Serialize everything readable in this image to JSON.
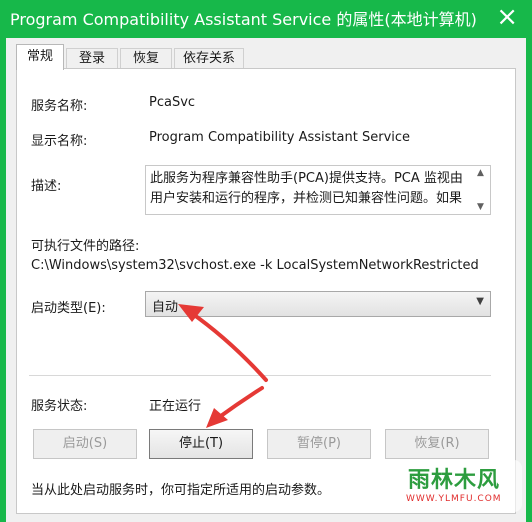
{
  "window": {
    "title": "Program Compatibility Assistant Service 的属性(本地计算机)",
    "close_glyph": "×"
  },
  "tabs": [
    {
      "label": "常规",
      "active": true
    },
    {
      "label": "登录",
      "active": false
    },
    {
      "label": "恢复",
      "active": false
    },
    {
      "label": "依存关系",
      "active": false
    }
  ],
  "general": {
    "service_name_label": "服务名称:",
    "service_name_value": "PcaSvc",
    "display_name_label": "显示名称:",
    "display_name_value": "Program Compatibility Assistant Service",
    "description_label": "描述:",
    "description_value": "此服务为程序兼容性助手(PCA)提供支持。PCA 监视由用户安装和运行的程序，并检测已知兼容性问题。如果",
    "path_label": "可执行文件的路径:",
    "path_value": "C:\\Windows\\system32\\svchost.exe -k LocalSystemNetworkRestricted",
    "startup_type_label": "启动类型(E):",
    "startup_type_value": "自动",
    "status_label": "服务状态:",
    "status_value": "正在运行",
    "hint": "当从此处启动服务时，你可指定所适用的启动参数。"
  },
  "buttons": {
    "start": {
      "label": "启动(S)",
      "enabled": false
    },
    "stop": {
      "label": "停止(T)",
      "enabled": true
    },
    "pause": {
      "label": "暂停(P)",
      "enabled": false
    },
    "resume": {
      "label": "恢复(R)",
      "enabled": false
    }
  },
  "watermark": {
    "logo": "雨林木风",
    "url": "WWW.YLMFU.COM"
  },
  "colors": {
    "title_bar": "#17b84a",
    "annotation_arrow": "#e53935"
  }
}
